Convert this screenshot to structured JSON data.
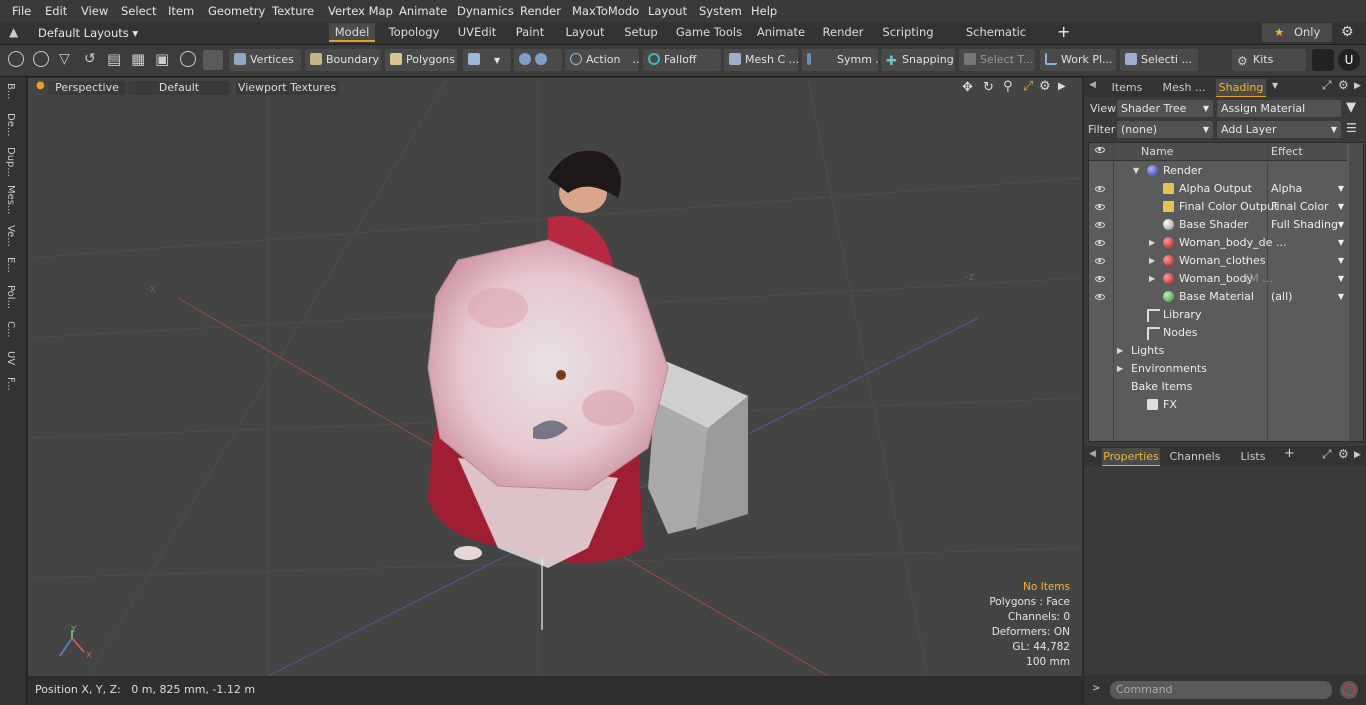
{
  "menu": [
    "File",
    "Edit",
    "View",
    "Select",
    "Item",
    "Geometry",
    "Texture",
    "Vertex Map",
    "Animate",
    "Dynamics",
    "Render",
    "MaxToModo",
    "Layout",
    "System",
    "Help"
  ],
  "layouts": {
    "dropdown": "Default Layouts",
    "tabs": [
      "Model",
      "Topology",
      "UVEdit",
      "Paint",
      "Layout",
      "Setup",
      "Game Tools",
      "Animate",
      "Render",
      "Scripting",
      "Schematic Fusion"
    ],
    "active_tab": "Model",
    "only_label": "Only"
  },
  "toolbar": {
    "vertices": "Vertices",
    "boundary": "Boundary",
    "polygons": "Polygons",
    "action": "Action",
    "falloff": "Falloff",
    "mesh": "Mesh C ...",
    "symm": "Symm ...",
    "snapping": "Snapping",
    "select_t": "Select T...",
    "work_pl": "Work Pl...",
    "selecti": "Selecti ...",
    "kits": "Kits"
  },
  "left_tabs": [
    "B...",
    "De...",
    "Dup...",
    "Mes...",
    "Ve...",
    "E...",
    "Pol...",
    "C...",
    "UV",
    "F..."
  ],
  "viewport": {
    "perspective": "Perspective",
    "default": "Default",
    "textures": "Viewport Textures",
    "stats": {
      "no_items": "No Items",
      "polygons": "Polygons : Face",
      "channels": "Channels: 0",
      "deformers": "Deformers: ON",
      "gl": "GL: 44,782",
      "scale": "100 mm"
    }
  },
  "status": {
    "position": "Position X, Y, Z:   0 m, 825 mm, -1.12 m"
  },
  "right_panel": {
    "tabs": [
      "Items",
      "Mesh ...",
      "Shading"
    ],
    "active_tab": "Shading",
    "view_label": "View",
    "view_value": "Shader Tree",
    "assign_material": "Assign Material",
    "filter_label": "Filter",
    "filter_value": "(none)",
    "add_layer": "Add Layer",
    "col_name": "Name",
    "col_effect": "Effect",
    "tree": [
      {
        "name": "Render",
        "effect": "",
        "indent": 1,
        "eye": false,
        "icon": "render",
        "toggle": "▼"
      },
      {
        "name": "Alpha Output",
        "effect": "Alpha",
        "indent": 2,
        "eye": true,
        "icon": "output",
        "toggle": ""
      },
      {
        "name": "Final Color Output",
        "effect": "Final Color",
        "indent": 2,
        "eye": true,
        "icon": "output",
        "toggle": ""
      },
      {
        "name": "Base Shader",
        "effect": "Full Shading",
        "indent": 2,
        "eye": true,
        "icon": "shader",
        "toggle": ""
      },
      {
        "name": "Woman_body_de ...",
        "effect": "",
        "indent": 2,
        "eye": true,
        "icon": "material-red",
        "toggle": "▶"
      },
      {
        "name": "Woman_clothes",
        "effect": "",
        "suffix": "( ...",
        "indent": 2,
        "eye": true,
        "icon": "material-red",
        "toggle": "▶"
      },
      {
        "name": "Woman_body",
        "effect": "",
        "suffix": "(M ...",
        "indent": 2,
        "eye": true,
        "icon": "material-red",
        "toggle": "▶"
      },
      {
        "name": "Base Material",
        "effect": "(all)",
        "indent": 2,
        "eye": true,
        "icon": "material-green",
        "toggle": ""
      },
      {
        "name": "Library",
        "effect": "",
        "indent": 1,
        "eye": false,
        "icon": "folder",
        "toggle": ""
      },
      {
        "name": "Nodes",
        "effect": "",
        "indent": 1,
        "eye": false,
        "icon": "folder",
        "toggle": ""
      },
      {
        "name": "Lights",
        "effect": "",
        "indent": 0,
        "eye": false,
        "icon": "",
        "toggle": "▶"
      },
      {
        "name": "Environments",
        "effect": "",
        "indent": 0,
        "eye": false,
        "icon": "",
        "toggle": "▶"
      },
      {
        "name": "Bake Items",
        "effect": "",
        "indent": 0,
        "eye": false,
        "icon": "",
        "toggle": ""
      },
      {
        "name": "FX",
        "effect": "",
        "indent": 1,
        "eye": false,
        "icon": "fx",
        "toggle": ""
      }
    ],
    "bottom_tabs": [
      "Properties",
      "Channels",
      "Lists"
    ],
    "bottom_active": "Properties",
    "command_placeholder": "Command"
  },
  "colors": {
    "accent": "#e9a227",
    "highlight_text": "#f2b630"
  }
}
